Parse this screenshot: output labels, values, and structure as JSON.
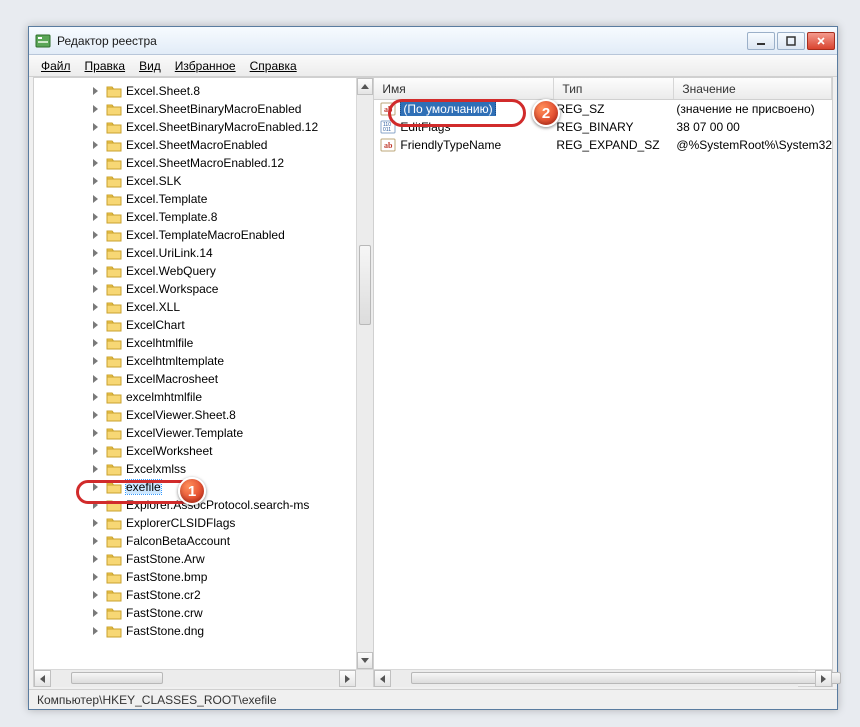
{
  "window": {
    "title": "Редактор реестра"
  },
  "menu": {
    "file": "Файл",
    "edit": "Правка",
    "view": "Вид",
    "favorites": "Избранное",
    "help": "Справка"
  },
  "tree": {
    "items": [
      "Excel.Sheet.8",
      "Excel.SheetBinaryMacroEnabled",
      "Excel.SheetBinaryMacroEnabled.12",
      "Excel.SheetMacroEnabled",
      "Excel.SheetMacroEnabled.12",
      "Excel.SLK",
      "Excel.Template",
      "Excel.Template.8",
      "Excel.TemplateMacroEnabled",
      "Excel.UriLink.14",
      "Excel.WebQuery",
      "Excel.Workspace",
      "Excel.XLL",
      "ExcelChart",
      "Excelhtmlfile",
      "Excelhtmltemplate",
      "ExcelMacrosheet",
      "excelmhtmlfile",
      "ExcelViewer.Sheet.8",
      "ExcelViewer.Template",
      "ExcelWorksheet",
      "Excelxmlss",
      "exefile",
      "Explorer.AssocProtocol.search-ms",
      "ExplorerCLSIDFlags",
      "FalconBetaAccount",
      "FastStone.Arw",
      "FastStone.bmp",
      "FastStone.cr2",
      "FastStone.crw",
      "FastStone.dng"
    ],
    "selected_index": 22
  },
  "list": {
    "columns": {
      "name": "Имя",
      "type": "Тип",
      "value": "Значение"
    },
    "rows": [
      {
        "icon": "string",
        "name": "(По умолчанию)",
        "type": "REG_SZ",
        "value": "(значение не присвоено)",
        "selected": true
      },
      {
        "icon": "binary",
        "name": "EditFlags",
        "type": "REG_BINARY",
        "value": "38 07 00 00"
      },
      {
        "icon": "string",
        "name": "FriendlyTypeName",
        "type": "REG_EXPAND_SZ",
        "value": "@%SystemRoot%\\System32"
      }
    ]
  },
  "statusbar": {
    "path": "Компьютер\\HKEY_CLASSES_ROOT\\exefile"
  },
  "annotations": {
    "badge1": "1",
    "badge2": "2"
  }
}
